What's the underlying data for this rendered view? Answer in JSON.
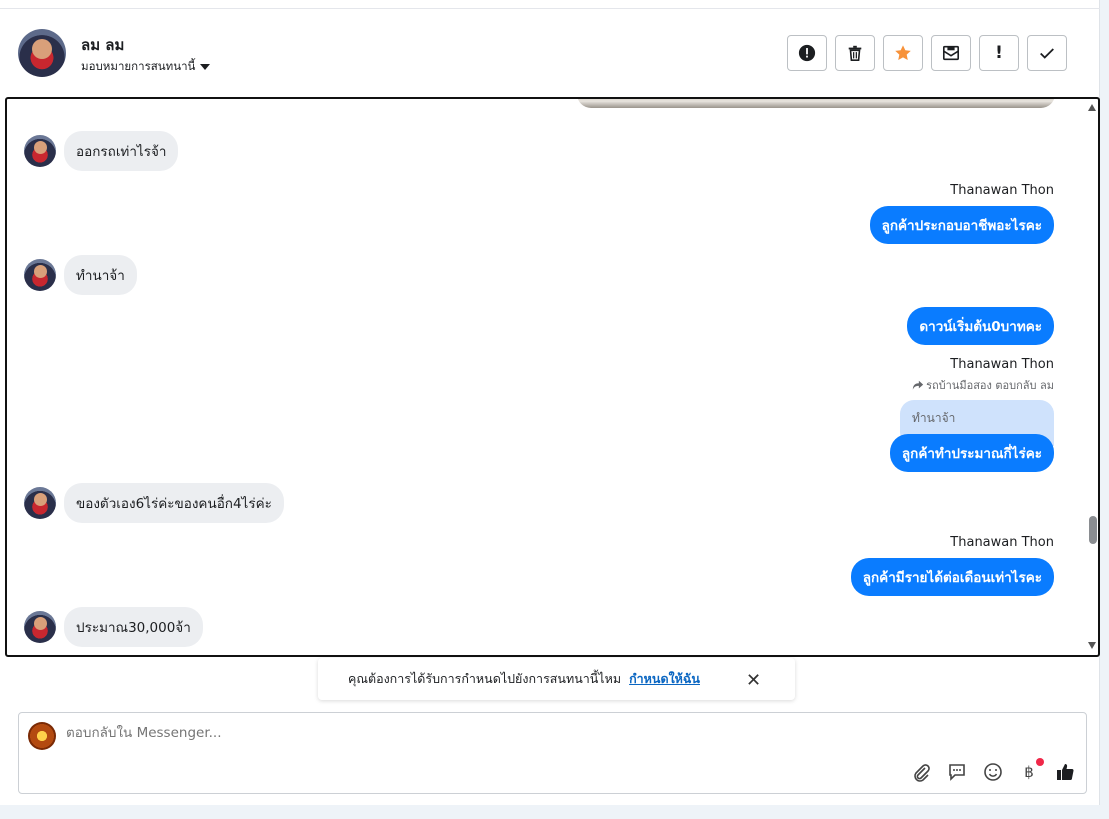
{
  "contact": {
    "name": "ลม ลม",
    "assign_label": "มอบหมายการสนทนานี้"
  },
  "toolbar": {
    "buttons": [
      {
        "name": "spam",
        "glyph": "!"
      },
      {
        "name": "delete"
      },
      {
        "name": "star"
      },
      {
        "name": "mark-unread"
      },
      {
        "name": "follow-up",
        "glyph": "!"
      },
      {
        "name": "done"
      }
    ],
    "star_color": "#f7923a"
  },
  "messages": [
    {
      "dir": "in",
      "text": "ออกรถเท่าไรจ้า"
    },
    {
      "dir": "out",
      "sender": "Thanawan Thon",
      "text": "ลูกค้าประกอบอาชีพอะไรคะ"
    },
    {
      "dir": "in",
      "text": "ทำนาจ้า"
    },
    {
      "dir": "out",
      "text": "ดาวน์เริ่มต้น0บาทคะ"
    },
    {
      "dir": "out",
      "sender": "Thanawan Thon",
      "reply_meta": "รถบ้านมือสอง ตอบกลับ ลม",
      "quoted": "ทำนาจ้า",
      "text": "ลูกค้าทำประมาณกี่ไร่คะ"
    },
    {
      "dir": "in",
      "text": "ของตัวเอง6ไร่ค่ะของคนอื่ก4ไร่ค่ะ"
    },
    {
      "dir": "out",
      "sender": "Thanawan Thon",
      "text": "ลูกค้ามีรายได้ต่อเดือนเท่าไรคะ"
    },
    {
      "dir": "in",
      "text": "ประมาณ30,000จ้า"
    }
  ],
  "notice": {
    "text": "คุณต้องการได้รับการกำหนดไปยังการสนทนานี้ไหม",
    "link": "กำหนดให้ฉัน"
  },
  "composer": {
    "placeholder": "ตอบกลับใน Messenger...",
    "currency_glyph": "฿"
  },
  "colors": {
    "accent": "#0a7cff",
    "incoming_bubble": "#eceef1",
    "quoted_bubble": "#cfe2fc"
  }
}
